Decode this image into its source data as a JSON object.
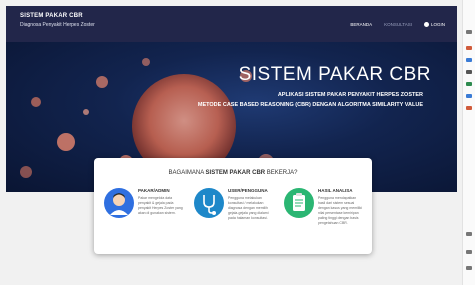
{
  "navbar": {
    "brand_title": "SISTEM PAKAR CBR",
    "brand_subtitle": "Diagnosa Penyakit Herpes Zoster",
    "links": [
      "BERANDA",
      "KONSULTASI",
      "LOGIN"
    ]
  },
  "hero": {
    "title": "SISTEM PAKAR CBR",
    "subtitle_line1": "APLIKASI SISTEM PAKAR PENYAKIT HERPES ZOSTER",
    "subtitle_line2": "METODE CASE BASED REASONING (CBR) DENGAN ALGORITMA SIMILARITY VALUE"
  },
  "info_card": {
    "heading_prefix": "BAGAIMANA",
    "heading_bold": "SISTEM PAKAR CBR",
    "heading_suffix": "BEKERJA?",
    "roles": [
      {
        "title": "PAKAR/ADMIN",
        "description": "Pakar mengelola data penyakit & gejala pada penyakit Herpes Zoster yang akan di gunakan sistem.",
        "color": "#2f6fe0",
        "icon": "doctor-avatar-icon"
      },
      {
        "title": "USER/PENGGUNA",
        "description": "Pengguna melakukan konsultasi / melakukan diagnosa dengan memilih gejala-gejala yang dialami pada halaman konsultasi.",
        "color": "#1e88c9",
        "icon": "stethoscope-icon"
      },
      {
        "title": "HASIL ANALISA",
        "description": "Pengguna mendapatkan hasil dari sistem sesuai dengan kasus yang memiliki nilai persentase kemiripan paling tinggi dengan basis pengetahuan CBR.",
        "color": "#2bb673",
        "icon": "clipboard-icon"
      }
    ]
  },
  "colors": {
    "navbar": "#22264a",
    "hero_dark": "#0a1533",
    "virus_particles": "#e8866e"
  }
}
